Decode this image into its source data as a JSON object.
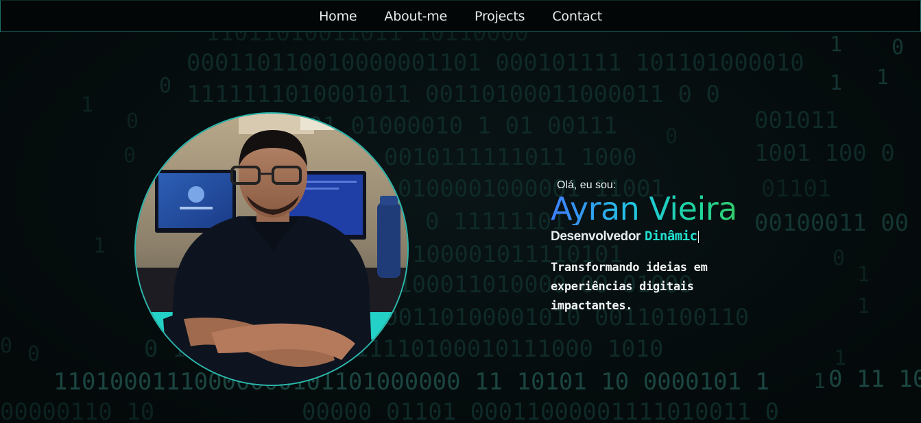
{
  "nav": {
    "items": [
      {
        "label": "Home"
      },
      {
        "label": "About-me"
      },
      {
        "label": "Projects"
      },
      {
        "label": "Contact"
      }
    ]
  },
  "hero": {
    "greeting": "Olá, eu sou:",
    "name": "Ayran Vieira",
    "role_static": "Desenvolvedor",
    "role_typed": "Dinâmic",
    "tagline": "Transformando ideias em experiências digitais impactantes."
  },
  "colors": {
    "background": "#050b0c",
    "accent_teal": "#22e0d0",
    "name_gradient_start": "#3f7fff",
    "name_gradient_end": "#31c96a",
    "portrait_border": "#2bb8ad",
    "binary_text": "#0f2a28"
  },
  "icons": {
    "portrait": "profile-photo"
  }
}
